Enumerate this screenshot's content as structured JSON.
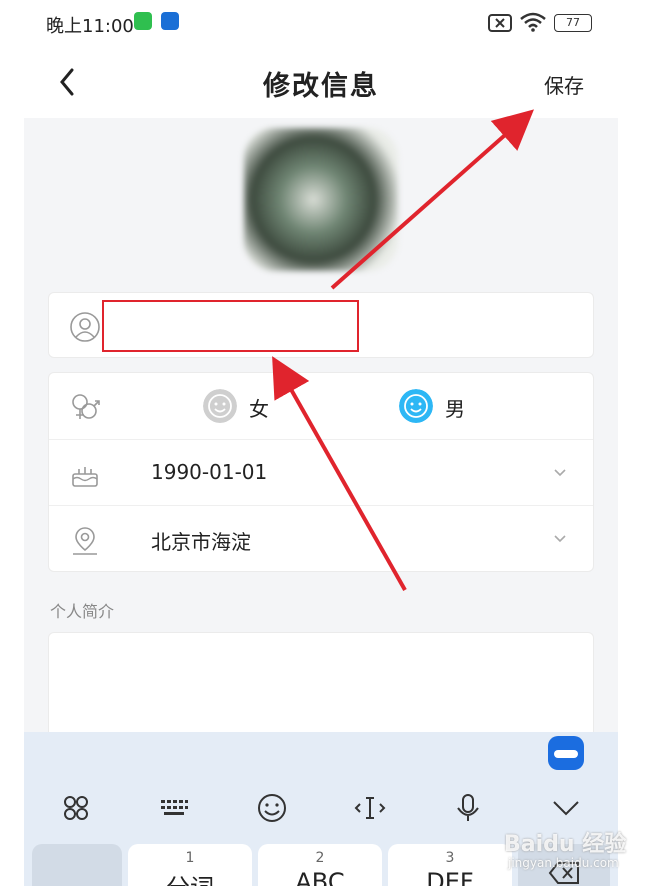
{
  "status_bar": {
    "time": "晚上11:00",
    "battery": "77"
  },
  "nav": {
    "title": "修改信息",
    "save_label": "保存"
  },
  "profile": {
    "name_value": "",
    "gender_options": [
      {
        "label": "女",
        "selected": false,
        "color": "#cfcfcf"
      },
      {
        "label": "男",
        "selected": true,
        "color": "#2db7f5"
      }
    ],
    "birthday": "1990-01-01",
    "location": "北京市海淀"
  },
  "bio": {
    "label": "个人简介",
    "value": ""
  },
  "keyboard": {
    "toolbar": [
      "grid-icon",
      "keyboard-icon",
      "emoji-icon",
      "cursor-icon",
      "microphone-icon",
      "collapse-icon"
    ],
    "keys": [
      {
        "num": "",
        "label": ","
      },
      {
        "num": "1",
        "label": "分词"
      },
      {
        "num": "2",
        "label": "ABC"
      },
      {
        "num": "3",
        "label": "DEF"
      }
    ]
  },
  "watermark": {
    "text": "Baidu 经验",
    "sub": "jingyan.baidu.com"
  },
  "colors": {
    "annotation": "#e0242d",
    "accent": "#2db7f5"
  }
}
